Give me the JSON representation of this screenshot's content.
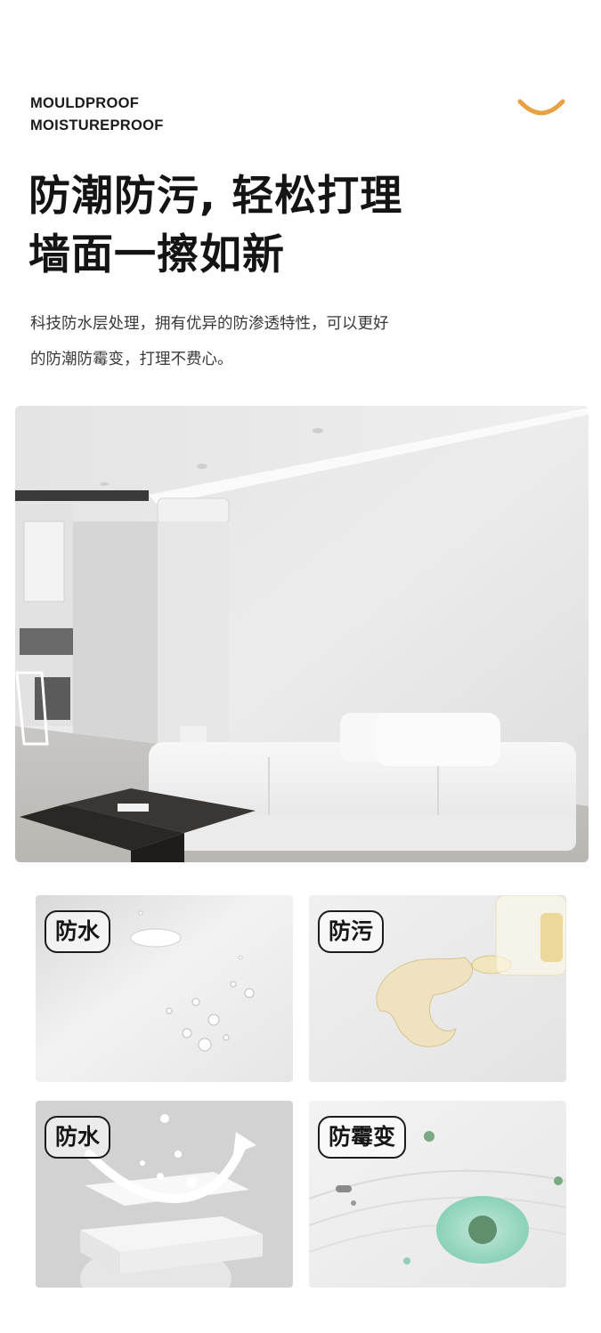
{
  "eyebrow": {
    "line1": "MOULDPROOF",
    "line2": "MOISTUREPROOF"
  },
  "accent_color": "#e8a143",
  "headline": {
    "line1": "防潮防污, 轻松打理",
    "line2": "墙面一擦如新"
  },
  "description": {
    "line1": "科技防水层处理，拥有优异的防渗透特性，可以更好",
    "line2": "的防潮防霉变，打理不费心。"
  },
  "features": [
    {
      "label": "防水"
    },
    {
      "label": "防污"
    },
    {
      "label": "防水"
    },
    {
      "label": "防霉变"
    }
  ]
}
